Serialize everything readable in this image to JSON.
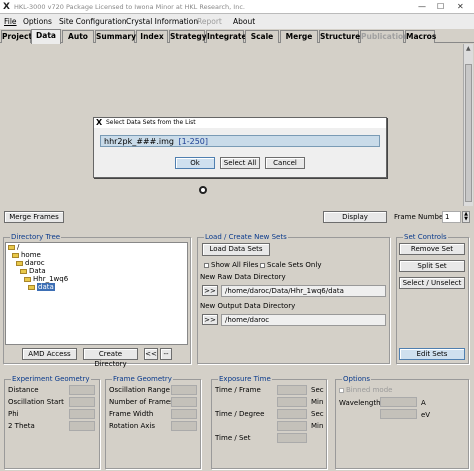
{
  "titlebar": {
    "app": "HKL-3000 v720",
    "license": "Package Licensed to Iwona Minor at HKL Research, Inc."
  },
  "menu": {
    "file": "File",
    "options": "Options",
    "site_config": "Site Configuration",
    "crystal_info": "Crystal Information",
    "report": "Report",
    "about": "About"
  },
  "tabs": [
    "Project",
    "Data",
    "Auto",
    "Summary",
    "Index",
    "Strategy",
    "Integrate",
    "Scale",
    "Merge",
    "Structure",
    "Publication",
    "Macros"
  ],
  "dialog": {
    "title": "Select Data Sets from the List",
    "entry_name": "hhr2pk_###.img",
    "entry_range": "[1-250]",
    "ok": "Ok",
    "select_all": "Select All",
    "cancel": "Cancel"
  },
  "bottom": {
    "merge_frames": "Merge Frames",
    "display": "Display",
    "frame_number_label": "Frame Number",
    "frame_number": "1"
  },
  "directory_tree": {
    "title": "Directory Tree",
    "items": [
      "/",
      "home",
      "daroc",
      "Data",
      "Hhr_1wq6",
      "data"
    ],
    "amd_access": "AMD Access",
    "create_directory": "Create Directory",
    "back": "<<",
    "dash": "--"
  },
  "load_sets": {
    "title": "Load / Create New Sets",
    "load_button": "Load Data Sets",
    "show_all_files": "Show All Files",
    "scale_sets_only": "Scale Sets Only",
    "raw_dir_label": "New Raw Data Directory",
    "raw_dir_btn": ">>",
    "raw_dir": "/home/daroc/Data/Hhr_1wq6/data",
    "out_dir_label": "New Output Data Directory",
    "out_dir_btn": ">>",
    "out_dir": "/home/daroc"
  },
  "set_controls": {
    "title": "Set Controls",
    "remove": "Remove Set",
    "split": "Split Set",
    "select_unselect": "Select / Unselect",
    "edit": "Edit Sets"
  },
  "experiment_geometry": {
    "title": "Experiment Geometry",
    "rows": [
      "Distance",
      "Oscillation Start",
      "Phi",
      "2 Theta"
    ]
  },
  "frame_geometry": {
    "title": "Frame Geometry",
    "rows": [
      "Oscillation Range",
      "Number of Frames",
      "Frame Width",
      "Rotation Axis"
    ]
  },
  "exposure_time": {
    "title": "Exposure Time",
    "rows": [
      {
        "label": "Time / Frame",
        "unit": "Sec"
      },
      {
        "label": "Time / Degree",
        "unit": "Min"
      },
      {
        "label": "",
        "unit": "Sec"
      },
      {
        "label": "Time / Set",
        "unit": ""
      }
    ]
  },
  "options": {
    "title": "Options",
    "binned_mode": "Binned mode",
    "wavelength": "Wavelength",
    "unit_a": "A",
    "unit_ev": "eV"
  }
}
